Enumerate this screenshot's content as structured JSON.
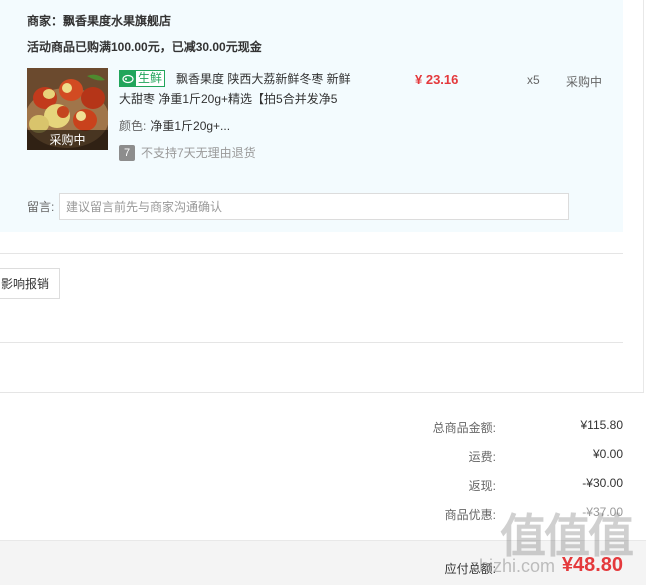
{
  "shop": {
    "label": "商家：",
    "name": "飘香果度水果旗舰店"
  },
  "promo": "活动商品已购满100.00元，已减30.00元现金",
  "item": {
    "thumb_badge": "采购中",
    "fresh_tag": "生鲜",
    "title_line1": "飘香果度 陕西大荔新鲜冬枣 新鲜",
    "title_line2": "大甜枣 净重1斤20g+精选【拍5合并发净5",
    "price": "¥ 23.16",
    "qty": "x5",
    "status": "采购中",
    "color_label": "颜色:",
    "color_value": "净重1斤20g+...",
    "return_icon_text": "7",
    "return_text": "不支持7天无理由退货"
  },
  "remark": {
    "label": "留言:",
    "placeholder": "建议留言前先与商家沟通确认"
  },
  "invoice_button": "影响报销",
  "summary": {
    "total_goods_label": "总商品金额:",
    "total_goods_value": "¥115.80",
    "shipping_label": "运费:",
    "shipping_value": "¥0.00",
    "cashback_label": "返现:",
    "cashback_value": "-¥30.00",
    "discount_label": "商品优惠:",
    "discount_value": "-¥37.00"
  },
  "payable": {
    "label": "应付总额:",
    "value": "¥48.80"
  },
  "watermark": {
    "logo": "值值值",
    "url": "zhizhi.com"
  },
  "colors": {
    "accent_red": "#e4393c",
    "fresh_green": "#22a55b",
    "block_bg": "#f3fbfe"
  }
}
